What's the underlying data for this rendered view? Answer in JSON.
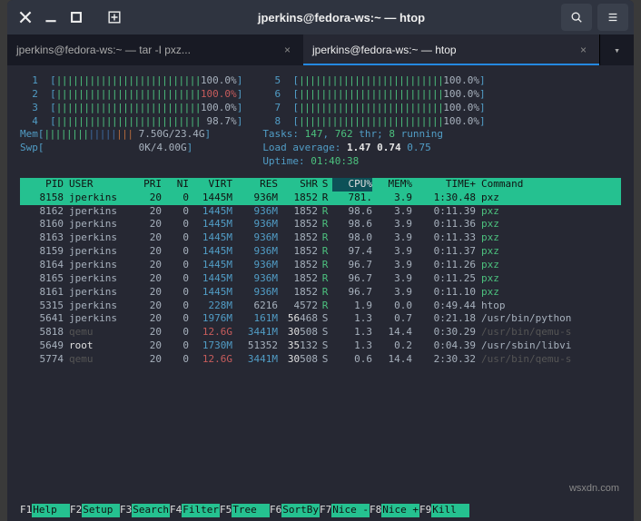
{
  "titlebar": {
    "title": "jperkins@fedora-ws:~ — htop"
  },
  "tabs": [
    {
      "label": "jperkins@fedora-ws:~ — tar -I pxz...",
      "active": false
    },
    {
      "label": "jperkins@fedora-ws:~ — htop",
      "active": true
    }
  ],
  "cpu_meters_left": [
    {
      "id": "1",
      "pct": "100.0%",
      "pct_class": "pct"
    },
    {
      "id": "2",
      "pct": "100.0%",
      "pct_class": "pctr"
    },
    {
      "id": "3",
      "pct": "100.0%",
      "pct_class": "pct"
    },
    {
      "id": "4",
      "pct": "98.7%",
      "pct_class": "pct"
    }
  ],
  "cpu_meters_right": [
    {
      "id": "5",
      "pct": "100.0%",
      "pct_class": "pct"
    },
    {
      "id": "6",
      "pct": "100.0%",
      "pct_class": "pct"
    },
    {
      "id": "7",
      "pct": "100.0%",
      "pct_class": "pct"
    },
    {
      "id": "8",
      "pct": "100.0%",
      "pct_class": "pct"
    }
  ],
  "mem": {
    "label": "Mem",
    "text": "7.50G/23.4G"
  },
  "swp": {
    "label": "Swp",
    "text": "0K/4.00G"
  },
  "sysinfo": {
    "tasks_label": "Tasks:",
    "tasks_procs": "147",
    "tasks_sep": ",",
    "tasks_thr_n": "762",
    "tasks_thr_l": "thr;",
    "tasks_run_n": "8",
    "tasks_run_l": "running",
    "load_label": "Load average:",
    "load1": "1.47",
    "load5": "0.74",
    "load15": "0.75",
    "uptime_label": "Uptime:",
    "uptime": "01:40:38"
  },
  "columns": {
    "pid": "PID",
    "user": "USER",
    "pri": "PRI",
    "ni": "NI",
    "virt": "VIRT",
    "res": "RES",
    "shr": "SHR",
    "s": "S",
    "cpu": "CPU%",
    "mem": "MEM%",
    "time": "TIME+",
    "cmd": "Command"
  },
  "rows": [
    {
      "pid": "8158",
      "user": "jperkins",
      "user_c": "",
      "pri": "20",
      "ni": "0",
      "virt": "1445M",
      "virt_c": "",
      "res": "936M",
      "res_c": "",
      "shr": "1852",
      "s": "R",
      "cpu": "781.",
      "mem": "3.9",
      "time": "1:30.48",
      "cmd": "pxz",
      "cmd_c": "",
      "hl": true
    },
    {
      "pid": "8162",
      "user": "jperkins",
      "user_c": "",
      "pri": "20",
      "ni": "0",
      "virt": "1445M",
      "virt_c": "v-c",
      "res": "936M",
      "res_c": "v-c",
      "shr": "1852",
      "s": "R",
      "s_c": "v-g",
      "cpu": "98.6",
      "mem": "3.9",
      "time": "0:11.39",
      "cmd": "pxz",
      "cmd_c": "v-g"
    },
    {
      "pid": "8160",
      "user": "jperkins",
      "user_c": "",
      "pri": "20",
      "ni": "0",
      "virt": "1445M",
      "virt_c": "v-c",
      "res": "936M",
      "res_c": "v-c",
      "shr": "1852",
      "s": "R",
      "s_c": "v-g",
      "cpu": "98.6",
      "mem": "3.9",
      "time": "0:11.36",
      "cmd": "pxz",
      "cmd_c": "v-g"
    },
    {
      "pid": "8163",
      "user": "jperkins",
      "user_c": "",
      "pri": "20",
      "ni": "0",
      "virt": "1445M",
      "virt_c": "v-c",
      "res": "936M",
      "res_c": "v-c",
      "shr": "1852",
      "s": "R",
      "s_c": "v-g",
      "cpu": "98.0",
      "mem": "3.9",
      "time": "0:11.33",
      "cmd": "pxz",
      "cmd_c": "v-g"
    },
    {
      "pid": "8159",
      "user": "jperkins",
      "user_c": "",
      "pri": "20",
      "ni": "0",
      "virt": "1445M",
      "virt_c": "v-c",
      "res": "936M",
      "res_c": "v-c",
      "shr": "1852",
      "s": "R",
      "s_c": "v-g",
      "cpu": "97.4",
      "mem": "3.9",
      "time": "0:11.37",
      "cmd": "pxz",
      "cmd_c": "v-g"
    },
    {
      "pid": "8164",
      "user": "jperkins",
      "user_c": "",
      "pri": "20",
      "ni": "0",
      "virt": "1445M",
      "virt_c": "v-c",
      "res": "936M",
      "res_c": "v-c",
      "shr": "1852",
      "s": "R",
      "s_c": "v-g",
      "cpu": "96.7",
      "mem": "3.9",
      "time": "0:11.26",
      "cmd": "pxz",
      "cmd_c": "v-g"
    },
    {
      "pid": "8165",
      "user": "jperkins",
      "user_c": "",
      "pri": "20",
      "ni": "0",
      "virt": "1445M",
      "virt_c": "v-c",
      "res": "936M",
      "res_c": "v-c",
      "shr": "1852",
      "s": "R",
      "s_c": "v-g",
      "cpu": "96.7",
      "mem": "3.9",
      "time": "0:11.25",
      "cmd": "pxz",
      "cmd_c": "v-g"
    },
    {
      "pid": "8161",
      "user": "jperkins",
      "user_c": "",
      "pri": "20",
      "ni": "0",
      "virt": "1445M",
      "virt_c": "v-c",
      "res": "936M",
      "res_c": "v-c",
      "shr": "1852",
      "s": "R",
      "s_c": "v-g",
      "cpu": "96.7",
      "mem": "3.9",
      "time": "0:11.10",
      "cmd": "pxz",
      "cmd_c": "v-g"
    },
    {
      "pid": "5315",
      "user": "jperkins",
      "user_c": "",
      "pri": "20",
      "ni": "0",
      "virt": "228M",
      "virt_c": "v-c",
      "res": "6216",
      "res_c": "",
      "shr": "4572",
      "s": "R",
      "s_c": "v-g",
      "cpu": "1.9",
      "mem": "0.0",
      "time": "0:49.44",
      "cmd": "htop",
      "cmd_c": ""
    },
    {
      "pid": "5641",
      "user": "jperkins",
      "user_c": "",
      "pri": "20",
      "ni": "0",
      "virt": "1976M",
      "virt_c": "v-c",
      "res": "161M",
      "res_c": "v-c",
      "shr": "56468",
      "s": "S",
      "s_c": "",
      "cpu": "1.3",
      "mem": "0.7",
      "time": "0:21.18",
      "cmd": "/usr/bin/python",
      "cmd_c": ""
    },
    {
      "pid": "5818",
      "user": "qemu",
      "user_c": "qemu-u",
      "pri": "20",
      "ni": "0",
      "virt": "12.6G",
      "virt_c": "v-r",
      "res": "3441M",
      "res_c": "v-c",
      "shr": "30508",
      "s": "S",
      "s_c": "",
      "cpu": "1.3",
      "mem": "14.4",
      "time": "0:30.29",
      "cmd": "/usr/bin/qemu-s",
      "cmd_c": "qemu-cmd"
    },
    {
      "pid": "5649",
      "user": "root",
      "user_c": "root-u",
      "pri": "20",
      "ni": "0",
      "virt": "1730M",
      "virt_c": "v-c",
      "res": "51352",
      "res_c": "",
      "shr": "35132",
      "s": "S",
      "s_c": "",
      "cpu": "1.3",
      "mem": "0.2",
      "time": "0:04.39",
      "cmd": "/usr/sbin/libvi",
      "cmd_c": ""
    },
    {
      "pid": "5774",
      "user": "qemu",
      "user_c": "qemu-u",
      "pri": "20",
      "ni": "0",
      "virt": "12.6G",
      "virt_c": "v-r",
      "res": "3441M",
      "res_c": "v-c",
      "shr": "30508",
      "s": "S",
      "s_c": "",
      "cpu": "0.6",
      "mem": "14.4",
      "time": "2:30.32",
      "cmd": "/usr/bin/qemu-s",
      "cmd_c": "qemu-cmd"
    }
  ],
  "fkeys": [
    {
      "k": "F1",
      "l": "Help  "
    },
    {
      "k": "F2",
      "l": "Setup "
    },
    {
      "k": "F3",
      "l": "Search"
    },
    {
      "k": "F4",
      "l": "Filter"
    },
    {
      "k": "F5",
      "l": "Tree  "
    },
    {
      "k": "F6",
      "l": "SortBy"
    },
    {
      "k": "F7",
      "l": "Nice -"
    },
    {
      "k": "F8",
      "l": "Nice +"
    },
    {
      "k": "F9",
      "l": "Kill  "
    }
  ],
  "watermark": "wsxdn.com"
}
